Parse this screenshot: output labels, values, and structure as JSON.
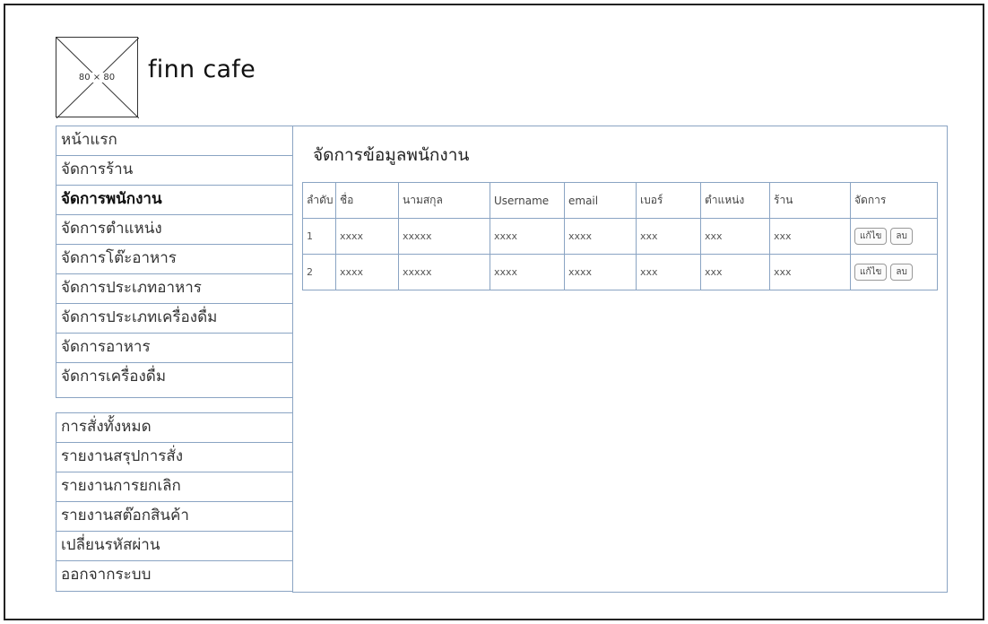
{
  "brand": {
    "logo_placeholder": "80 × 80",
    "name": "finn cafe"
  },
  "sidebar": {
    "group1": [
      {
        "label": "หน้าแรก",
        "active": false
      },
      {
        "label": "จัดการร้าน",
        "active": false
      },
      {
        "label": "จัดการพนักงาน",
        "active": true
      },
      {
        "label": "จัดการตำแหน่ง",
        "active": false
      },
      {
        "label": "จัดการโต๊ะอาหาร",
        "active": false
      },
      {
        "label": "จัดการประเภทอาหาร",
        "active": false
      },
      {
        "label": "จัดการประเภทเครื่องดื่ม",
        "active": false
      },
      {
        "label": "จัดการอาหาร",
        "active": false
      },
      {
        "label": "จัดการเครื่องดื่ม",
        "active": false
      }
    ],
    "group2": [
      {
        "label": "การสั่งทั้งหมด"
      },
      {
        "label": "รายงานสรุปการสั่ง"
      },
      {
        "label": "รายงานการยกเลิก"
      },
      {
        "label": "รายงานสต๊อกสินค้า"
      },
      {
        "label": "เปลี่ยนรหัสผ่าน"
      },
      {
        "label": "ออกจากระบบ"
      }
    ]
  },
  "main": {
    "title": "จัดการข้อมูลพนักงาน",
    "table": {
      "headers": [
        "ลำดับ",
        "ชื่อ",
        "นามสกุล",
        "Username",
        "email",
        "เบอร์",
        "ตำแหน่ง",
        "ร้าน",
        "จัดการ"
      ],
      "rows": [
        [
          "1",
          "xxxx",
          "xxxxx",
          "xxxx",
          "xxxx",
          "xxx",
          "xxx",
          "xxx"
        ],
        [
          "2",
          "xxxx",
          "xxxxx",
          "xxxx",
          "xxxx",
          "xxx",
          "xxx",
          "xxx"
        ]
      ],
      "edit_label": "แก้ไข",
      "delete_label": "ลบ"
    }
  }
}
